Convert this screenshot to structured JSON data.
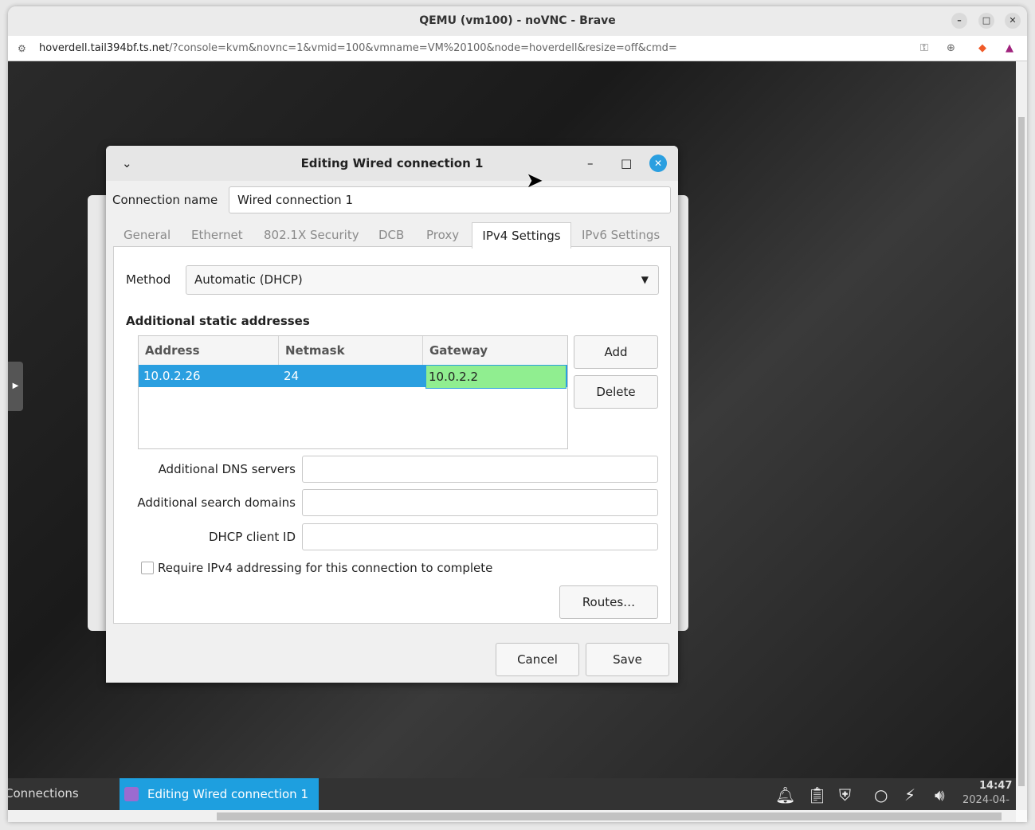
{
  "browser": {
    "title": "QEMU (vm100) - noVNC - Brave",
    "url_host": "hoverdell.tail394bf.ts.net",
    "url_rest": "/?console=kvm&novnc=1&vmid=100&vmname=VM%20100&node=hoverdell&resize=off&cmd="
  },
  "dialog": {
    "title": "Editing Wired connection 1",
    "connection_name_label": "Connection name",
    "connection_name_value": "Wired connection 1",
    "tabs": [
      "General",
      "Ethernet",
      "802.1X Security",
      "DCB",
      "Proxy",
      "IPv4 Settings",
      "IPv6 Settings"
    ],
    "active_tab": "IPv4 Settings",
    "method_label": "Method",
    "method_value": "Automatic (DHCP)",
    "static_heading": "Additional static addresses",
    "columns": [
      "Address",
      "Netmask",
      "Gateway"
    ],
    "rows": [
      {
        "address": "10.0.2.26",
        "netmask": "24",
        "gateway": "10.0.2.2"
      }
    ],
    "add": "Add",
    "delete": "Delete",
    "dns_label": "Additional DNS servers",
    "dns_value": "",
    "search_label": "Additional search domains",
    "search_value": "",
    "dhcp_label": "DHCP client ID",
    "dhcp_value": "",
    "require_label": "Require IPv4 addressing for this connection to complete",
    "require_checked": false,
    "routes": "Routes…",
    "cancel": "Cancel",
    "save": "Save"
  },
  "taskbar": {
    "left_item": "Connections",
    "active_item": "Editing Wired connection 1",
    "time": "14:47",
    "date": "2024-04-"
  },
  "colors": {
    "accent": "#2a9fe0",
    "gateway_edit": "#90ee90",
    "taskbar": "#333333"
  }
}
